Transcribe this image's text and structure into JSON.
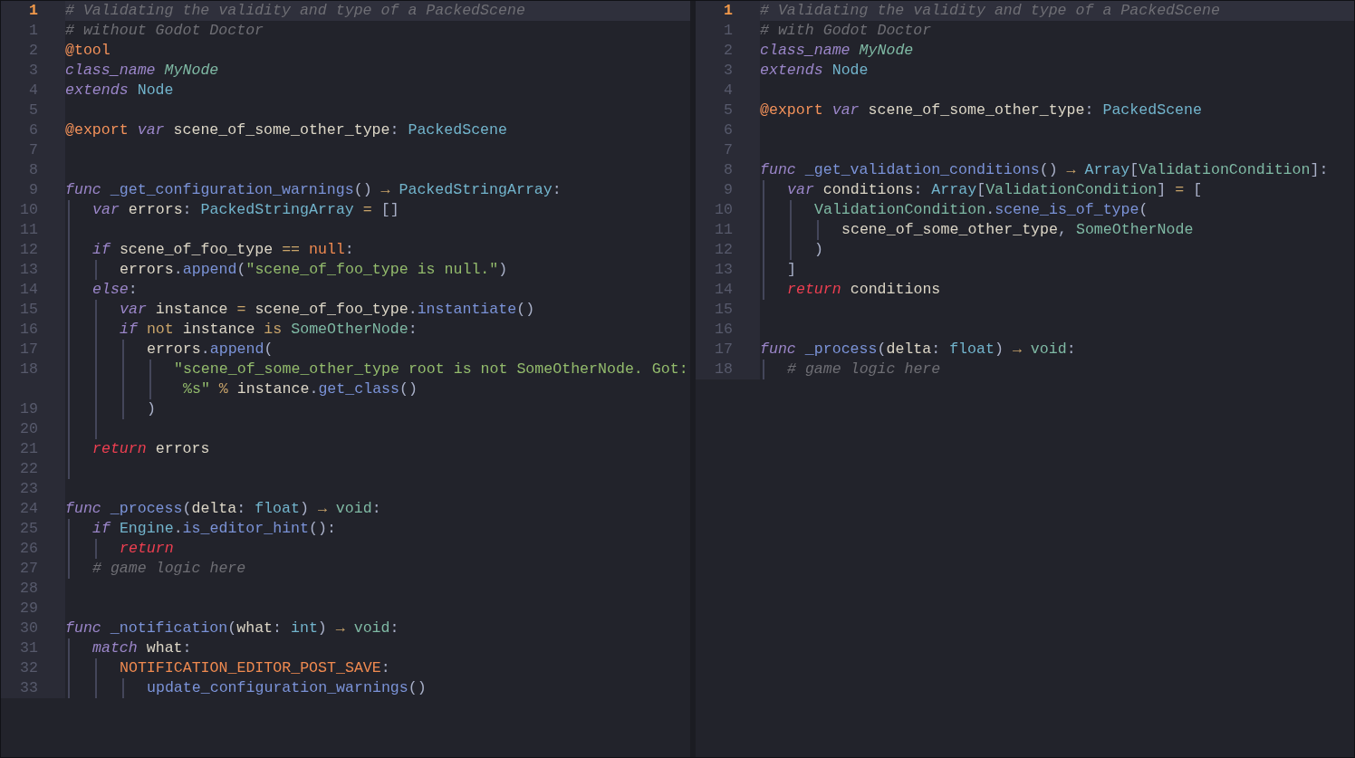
{
  "panes": [
    {
      "lines": [
        {
          "number": "1",
          "current": true,
          "tokens": [
            {
              "kind": "comment",
              "text": "# Validating the validity and type of a PackedScene"
            }
          ]
        },
        {
          "number": "1",
          "current": false,
          "tokens": [
            {
              "kind": "comment",
              "text": "# without Godot Doctor"
            }
          ]
        },
        {
          "number": "2",
          "current": false,
          "tokens": [
            {
              "kind": "annotation",
              "text": "@tool"
            }
          ]
        },
        {
          "number": "3",
          "current": false,
          "tokens": [
            {
              "kind": "keyword",
              "text": "class_name "
            },
            {
              "kind": "classname",
              "text": "MyNode"
            }
          ]
        },
        {
          "number": "4",
          "current": false,
          "tokens": [
            {
              "kind": "keyword",
              "text": "extends "
            },
            {
              "kind": "type",
              "text": "Node"
            }
          ]
        },
        {
          "number": "5",
          "current": false
        },
        {
          "number": "6",
          "current": false,
          "tokens": [
            {
              "kind": "annotation",
              "text": "@export "
            },
            {
              "kind": "keyword",
              "text": "var "
            },
            {
              "kind": "ident",
              "text": "scene_of_some_other_type"
            },
            {
              "kind": "punct",
              "text": ": "
            },
            {
              "kind": "type",
              "text": "PackedScene"
            }
          ]
        },
        {
          "number": "7",
          "current": false
        },
        {
          "number": "8",
          "current": false
        },
        {
          "number": "9",
          "current": false,
          "tokens": [
            {
              "kind": "keyword",
              "text": "func "
            },
            {
              "kind": "function",
              "text": "_get_configuration_warnings"
            },
            {
              "kind": "punct",
              "text": "() "
            },
            {
              "kind": "operator",
              "text": "→ "
            },
            {
              "kind": "type",
              "text": "PackedStringArray"
            },
            {
              "kind": "punct",
              "text": ":"
            }
          ],
          "children": [
            {
              "number": "10",
              "current": false,
              "tokens": [
                {
                  "kind": "keyword",
                  "text": "var "
                },
                {
                  "kind": "ident",
                  "text": "errors"
                },
                {
                  "kind": "punct",
                  "text": ": "
                },
                {
                  "kind": "type",
                  "text": "PackedStringArray "
                },
                {
                  "kind": "operator",
                  "text": "= "
                },
                {
                  "kind": "punct",
                  "text": "[]"
                }
              ]
            },
            {
              "number": "11",
              "current": false
            },
            {
              "number": "12",
              "current": false,
              "tokens": [
                {
                  "kind": "keyword",
                  "text": "if "
                },
                {
                  "kind": "ident",
                  "text": "scene_of_foo_type "
                },
                {
                  "kind": "operator",
                  "text": "== "
                },
                {
                  "kind": "constant",
                  "text": "null"
                },
                {
                  "kind": "punct",
                  "text": ":"
                }
              ],
              "children": [
                {
                  "number": "13",
                  "current": false,
                  "tokens": [
                    {
                      "kind": "ident",
                      "text": "errors"
                    },
                    {
                      "kind": "punct",
                      "text": "."
                    },
                    {
                      "kind": "function",
                      "text": "append"
                    },
                    {
                      "kind": "punct",
                      "text": "("
                    },
                    {
                      "kind": "string",
                      "text": "\"scene_of_foo_type is null.\""
                    },
                    {
                      "kind": "punct",
                      "text": ")"
                    }
                  ]
                }
              ]
            },
            {
              "number": "14",
              "current": false,
              "tokens": [
                {
                  "kind": "keyword",
                  "text": "else"
                },
                {
                  "kind": "punct",
                  "text": ":"
                }
              ],
              "children": [
                {
                  "number": "15",
                  "current": false,
                  "tokens": [
                    {
                      "kind": "keyword",
                      "text": "var "
                    },
                    {
                      "kind": "ident",
                      "text": "instance "
                    },
                    {
                      "kind": "operator",
                      "text": "= "
                    },
                    {
                      "kind": "ident",
                      "text": "scene_of_foo_type"
                    },
                    {
                      "kind": "punct",
                      "text": "."
                    },
                    {
                      "kind": "function",
                      "text": "instantiate"
                    },
                    {
                      "kind": "punct",
                      "text": "()"
                    }
                  ]
                },
                {
                  "number": "16",
                  "current": false,
                  "tokens": [
                    {
                      "kind": "keyword",
                      "text": "if "
                    },
                    {
                      "kind": "operator",
                      "text": "not "
                    },
                    {
                      "kind": "ident",
                      "text": "instance "
                    },
                    {
                      "kind": "operator",
                      "text": "is "
                    },
                    {
                      "kind": "class",
                      "text": "SomeOtherNode"
                    },
                    {
                      "kind": "punct",
                      "text": ":"
                    }
                  ],
                  "children": [
                    {
                      "number": "17",
                      "current": false,
                      "tokens": [
                        {
                          "kind": "ident",
                          "text": "errors"
                        },
                        {
                          "kind": "punct",
                          "text": "."
                        },
                        {
                          "kind": "function",
                          "text": "append"
                        },
                        {
                          "kind": "punct",
                          "text": "("
                        }
                      ],
                      "children": [
                        {
                          "number": "18",
                          "current": false,
                          "tokens": [
                            {
                              "kind": "string",
                              "text": "\"scene_of_some_other_type root is not SomeOtherNode. Got:"
                            }
                          ],
                          "wrap": [
                            {
                              "kind": "string",
                              "text": "%s\""
                            },
                            {
                              "kind": "operator",
                              "text": " % "
                            },
                            {
                              "kind": "ident",
                              "text": "instance"
                            },
                            {
                              "kind": "punct",
                              "text": "."
                            },
                            {
                              "kind": "function",
                              "text": "get_class"
                            },
                            {
                              "kind": "punct",
                              "text": "()"
                            }
                          ]
                        }
                      ]
                    },
                    {
                      "number": "19",
                      "current": false,
                      "tokens": [
                        {
                          "kind": "punct",
                          "text": ")"
                        }
                      ]
                    }
                  ]
                },
                {
                  "number": "20",
                  "current": false
                }
              ]
            },
            {
              "number": "21",
              "current": false,
              "tokens": [
                {
                  "kind": "control",
                  "text": "return "
                },
                {
                  "kind": "ident",
                  "text": "errors"
                }
              ]
            },
            {
              "number": "22",
              "current": false
            }
          ]
        },
        {
          "number": "23",
          "current": false
        },
        {
          "number": "24",
          "current": false,
          "tokens": [
            {
              "kind": "keyword",
              "text": "func "
            },
            {
              "kind": "function",
              "text": "_process"
            },
            {
              "kind": "punct",
              "text": "("
            },
            {
              "kind": "ident",
              "text": "delta"
            },
            {
              "kind": "punct",
              "text": ": "
            },
            {
              "kind": "type",
              "text": "float"
            },
            {
              "kind": "punct",
              "text": ") "
            },
            {
              "kind": "operator",
              "text": "→ "
            },
            {
              "kind": "class",
              "text": "void"
            },
            {
              "kind": "punct",
              "text": ":"
            }
          ],
          "children": [
            {
              "number": "25",
              "current": false,
              "tokens": [
                {
                  "kind": "keyword",
                  "text": "if "
                },
                {
                  "kind": "type",
                  "text": "Engine"
                },
                {
                  "kind": "punct",
                  "text": "."
                },
                {
                  "kind": "function",
                  "text": "is_editor_hint"
                },
                {
                  "kind": "punct",
                  "text": "():"
                }
              ],
              "children": [
                {
                  "number": "26",
                  "current": false,
                  "tokens": [
                    {
                      "kind": "control",
                      "text": "return"
                    }
                  ]
                }
              ]
            },
            {
              "number": "27",
              "current": false,
              "tokens": [
                {
                  "kind": "comment",
                  "text": "# game logic here"
                }
              ]
            }
          ]
        },
        {
          "number": "28",
          "current": false
        },
        {
          "number": "29",
          "current": false
        },
        {
          "number": "30",
          "current": false,
          "tokens": [
            {
              "kind": "keyword",
              "text": "func "
            },
            {
              "kind": "function",
              "text": "_notification"
            },
            {
              "kind": "punct",
              "text": "("
            },
            {
              "kind": "ident",
              "text": "what"
            },
            {
              "kind": "punct",
              "text": ": "
            },
            {
              "kind": "type",
              "text": "int"
            },
            {
              "kind": "punct",
              "text": ") "
            },
            {
              "kind": "operator",
              "text": "→ "
            },
            {
              "kind": "class",
              "text": "void"
            },
            {
              "kind": "punct",
              "text": ":"
            }
          ],
          "children": [
            {
              "number": "31",
              "current": false,
              "tokens": [
                {
                  "kind": "keyword",
                  "text": "match "
                },
                {
                  "kind": "ident",
                  "text": "what"
                },
                {
                  "kind": "punct",
                  "text": ":"
                }
              ],
              "children": [
                {
                  "number": "32",
                  "current": false,
                  "tokens": [
                    {
                      "kind": "constant",
                      "text": "NOTIFICATION_EDITOR_POST_SAVE"
                    },
                    {
                      "kind": "punct",
                      "text": ":"
                    }
                  ],
                  "children": [
                    {
                      "number": "33",
                      "current": false,
                      "tokens": [
                        {
                          "kind": "function",
                          "text": "update_configuration_warnings"
                        },
                        {
                          "kind": "punct",
                          "text": "()"
                        }
                      ]
                    }
                  ]
                }
              ]
            }
          ]
        }
      ]
    },
    {
      "lines": [
        {
          "number": "1",
          "current": true,
          "tokens": [
            {
              "kind": "comment",
              "text": "# Validating the validity and type of a PackedScene"
            }
          ]
        },
        {
          "number": "1",
          "current": false,
          "tokens": [
            {
              "kind": "comment",
              "text": "# with Godot Doctor"
            }
          ]
        },
        {
          "number": "2",
          "current": false,
          "tokens": [
            {
              "kind": "keyword",
              "text": "class_name "
            },
            {
              "kind": "classname",
              "text": "MyNode"
            }
          ]
        },
        {
          "number": "3",
          "current": false,
          "tokens": [
            {
              "kind": "keyword",
              "text": "extends "
            },
            {
              "kind": "type",
              "text": "Node"
            }
          ]
        },
        {
          "number": "4",
          "current": false
        },
        {
          "number": "5",
          "current": false,
          "tokens": [
            {
              "kind": "annotation",
              "text": "@export "
            },
            {
              "kind": "keyword",
              "text": "var "
            },
            {
              "kind": "ident",
              "text": "scene_of_some_other_type"
            },
            {
              "kind": "punct",
              "text": ": "
            },
            {
              "kind": "type",
              "text": "PackedScene"
            }
          ]
        },
        {
          "number": "6",
          "current": false
        },
        {
          "number": "7",
          "current": false
        },
        {
          "number": "8",
          "current": false,
          "tokens": [
            {
              "kind": "keyword",
              "text": "func "
            },
            {
              "kind": "function",
              "text": "_get_validation_conditions"
            },
            {
              "kind": "punct",
              "text": "() "
            },
            {
              "kind": "operator",
              "text": "→ "
            },
            {
              "kind": "type",
              "text": "Array"
            },
            {
              "kind": "punct",
              "text": "["
            },
            {
              "kind": "class",
              "text": "ValidationCondition"
            },
            {
              "kind": "punct",
              "text": "]:"
            }
          ],
          "children": [
            {
              "number": "9",
              "current": false,
              "tokens": [
                {
                  "kind": "keyword",
                  "text": "var "
                },
                {
                  "kind": "ident",
                  "text": "conditions"
                },
                {
                  "kind": "punct",
                  "text": ": "
                },
                {
                  "kind": "type",
                  "text": "Array"
                },
                {
                  "kind": "punct",
                  "text": "["
                },
                {
                  "kind": "class",
                  "text": "ValidationCondition"
                },
                {
                  "kind": "punct",
                  "text": "] "
                },
                {
                  "kind": "operator",
                  "text": "= "
                },
                {
                  "kind": "punct",
                  "text": "["
                }
              ],
              "children": [
                {
                  "number": "10",
                  "current": false,
                  "tokens": [
                    {
                      "kind": "class",
                      "text": "ValidationCondition"
                    },
                    {
                      "kind": "punct",
                      "text": "."
                    },
                    {
                      "kind": "function",
                      "text": "scene_is_of_type"
                    },
                    {
                      "kind": "punct",
                      "text": "("
                    }
                  ],
                  "children": [
                    {
                      "number": "11",
                      "current": false,
                      "tokens": [
                        {
                          "kind": "ident",
                          "text": "scene_of_some_other_type"
                        },
                        {
                          "kind": "punct",
                          "text": ", "
                        },
                        {
                          "kind": "class",
                          "text": "SomeOtherNode"
                        }
                      ]
                    }
                  ]
                },
                {
                  "number": "12",
                  "current": false,
                  "tokens": [
                    {
                      "kind": "punct",
                      "text": ")"
                    }
                  ]
                }
              ]
            },
            {
              "number": "13",
              "current": false,
              "tokens": [
                {
                  "kind": "punct",
                  "text": "]"
                }
              ]
            },
            {
              "number": "14",
              "current": false,
              "tokens": [
                {
                  "kind": "control",
                  "text": "return "
                },
                {
                  "kind": "ident",
                  "text": "conditions"
                }
              ]
            }
          ]
        },
        {
          "number": "15",
          "current": false
        },
        {
          "number": "16",
          "current": false
        },
        {
          "number": "17",
          "current": false,
          "tokens": [
            {
              "kind": "keyword",
              "text": "func "
            },
            {
              "kind": "function",
              "text": "_process"
            },
            {
              "kind": "punct",
              "text": "("
            },
            {
              "kind": "ident",
              "text": "delta"
            },
            {
              "kind": "punct",
              "text": ": "
            },
            {
              "kind": "type",
              "text": "float"
            },
            {
              "kind": "punct",
              "text": ") "
            },
            {
              "kind": "operator",
              "text": "→ "
            },
            {
              "kind": "class",
              "text": "void"
            },
            {
              "kind": "punct",
              "text": ":"
            }
          ],
          "children": [
            {
              "number": "18",
              "current": false,
              "tokens": [
                {
                  "kind": "comment",
                  "text": "# game logic here"
                }
              ]
            }
          ]
        }
      ]
    }
  ]
}
